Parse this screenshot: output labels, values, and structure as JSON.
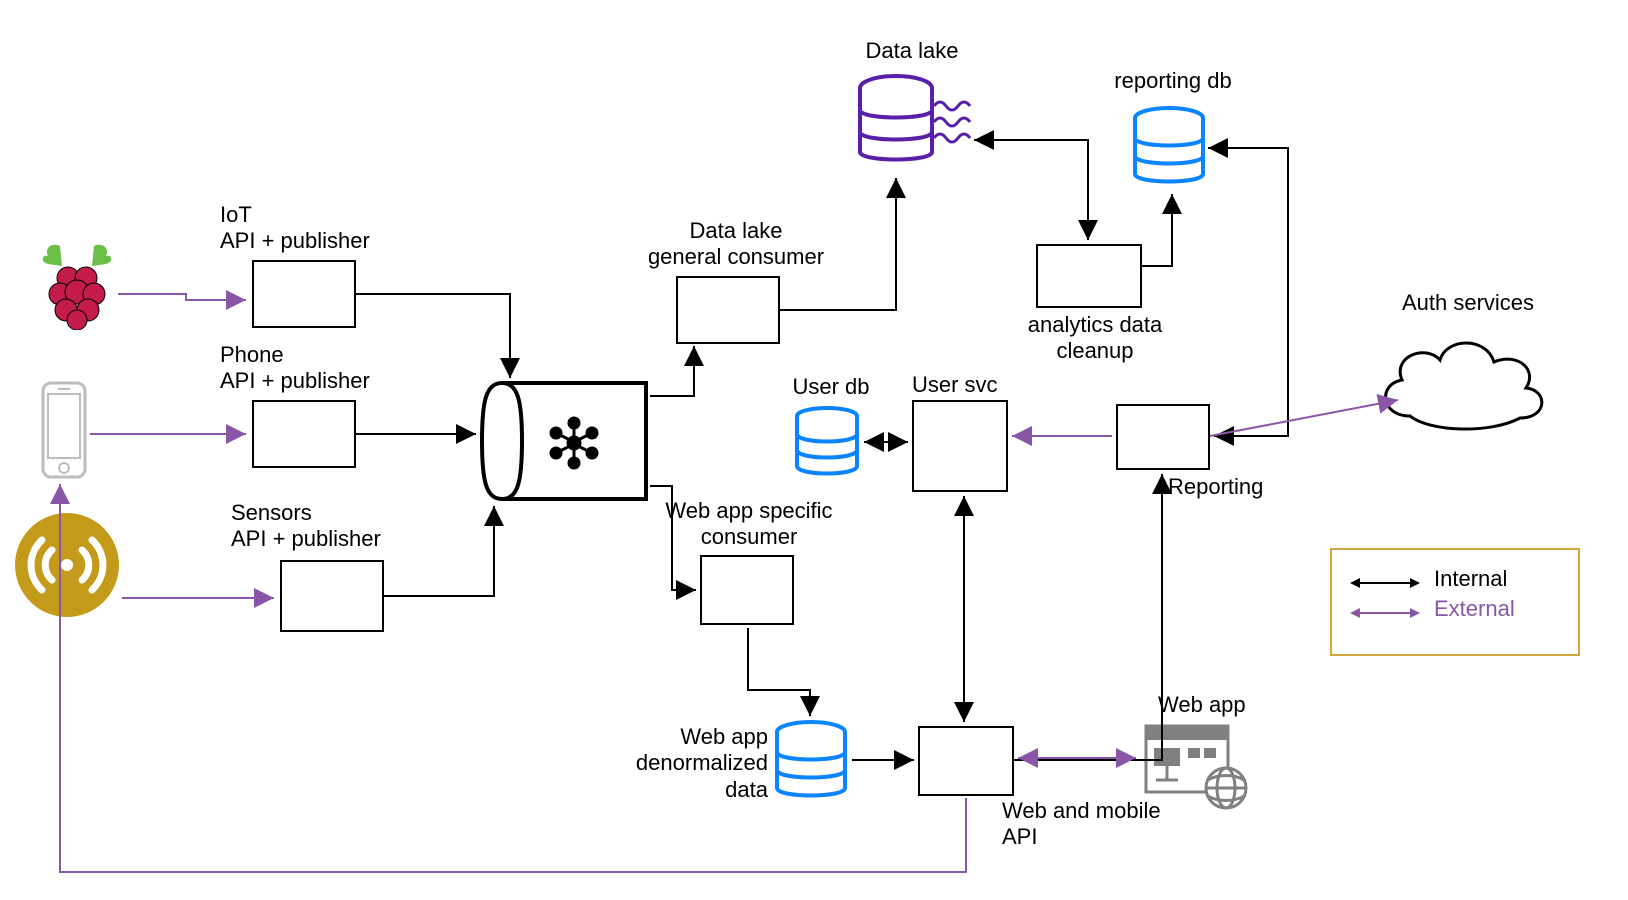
{
  "nodes": {
    "iot_api": {
      "label": "IoT\nAPI + publisher"
    },
    "phone_api": {
      "label": "Phone\nAPI + publisher"
    },
    "sensors_api": {
      "label": "Sensors\nAPI + publisher"
    },
    "dl_consumer": {
      "label": "Data lake\ngeneral consumer"
    },
    "wa_consumer": {
      "label": "Web app specific\nconsumer"
    },
    "data_lake": {
      "label": "Data lake"
    },
    "reporting_db": {
      "label": "reporting db"
    },
    "user_db": {
      "label": "User db"
    },
    "user_svc": {
      "label": "User svc"
    },
    "analytics": {
      "label": "analytics data\ncleanup"
    },
    "reporting": {
      "label": "Reporting"
    },
    "denorm": {
      "label": "Web app\ndenormalized\ndata"
    },
    "web_api": {
      "label": "Web and mobile\nAPI"
    },
    "web_app": {
      "label": "Web app"
    },
    "auth": {
      "label": "Auth services"
    }
  },
  "legend": {
    "internal": "Internal",
    "external": "External"
  },
  "colors": {
    "internal": "#000000",
    "external": "#8a56a8",
    "db_blue": "#0b84ff",
    "datalake_purple": "#5a1fa8",
    "legend_border": "#d4a73d",
    "raspberry_red": "#c31c4a",
    "raspberry_leaf": "#6bbf47",
    "sensor_gold": "#c49a1a",
    "phone_grey": "#bdbdbd",
    "icon_grey": "#808080"
  }
}
